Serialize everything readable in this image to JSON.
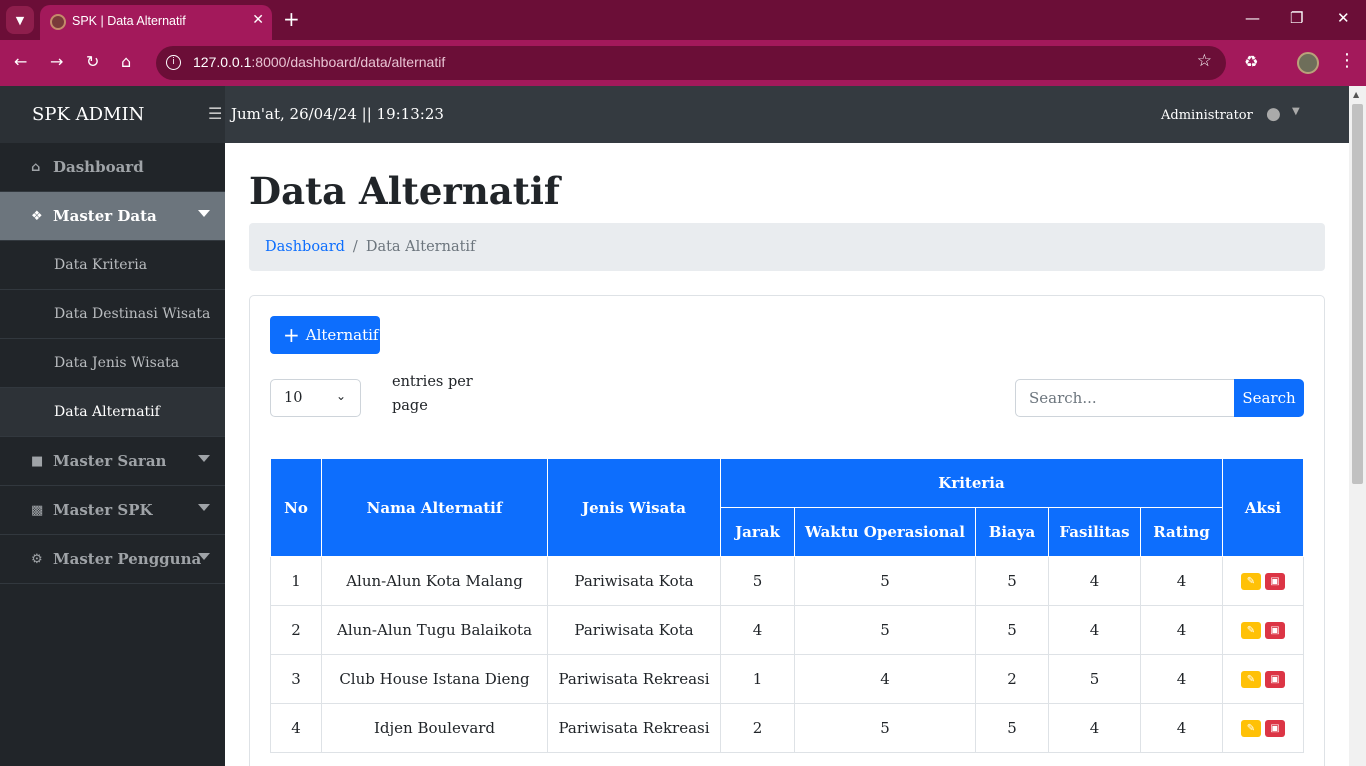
{
  "browser": {
    "tab_title": "SPK | Data Alternatif",
    "url_host": "127.0.0.1",
    "url_rest": ":8000/dashboard/data/alternatif"
  },
  "topbar": {
    "brand": "SPK ADMIN",
    "datetime": "Jum'at, 26/04/24 || 19:13:23",
    "user": "Administrator"
  },
  "sidebar": {
    "dashboard": "Dashboard",
    "master_data": "Master Data",
    "sub": [
      "Data Kriteria",
      "Data Destinasi Wisata",
      "Data Jenis Wisata",
      "Data Alternatif"
    ],
    "master_saran": "Master Saran",
    "master_spk": "Master SPK",
    "master_pengguna": "Master Pengguna"
  },
  "page": {
    "title": "Data Alternatif",
    "breadcrumb_link": "Dashboard",
    "breadcrumb_sep": "/",
    "breadcrumb_current": "Data Alternatif",
    "add_button": "Alternatif",
    "per_page": "10",
    "entries_label": "entries per page",
    "search_placeholder": "Search...",
    "search_button": "Search"
  },
  "table": {
    "headers": {
      "no": "No",
      "nama": "Nama Alternatif",
      "jenis": "Jenis Wisata",
      "kriteria": "Kriteria",
      "jarak": "Jarak",
      "waktu": "Waktu Operasional",
      "biaya": "Biaya",
      "fasilitas": "Fasilitas",
      "rating": "Rating",
      "aksi": "Aksi"
    },
    "rows": [
      {
        "no": "1",
        "nama": "Alun-Alun Kota Malang",
        "jenis": "Pariwisata Kota",
        "jarak": "5",
        "waktu": "5",
        "biaya": "5",
        "fasilitas": "4",
        "rating": "4"
      },
      {
        "no": "2",
        "nama": "Alun-Alun Tugu Balaikota",
        "jenis": "Pariwisata Kota",
        "jarak": "4",
        "waktu": "5",
        "biaya": "5",
        "fasilitas": "4",
        "rating": "4"
      },
      {
        "no": "3",
        "nama": "Club House Istana Dieng",
        "jenis": "Pariwisata Rekreasi",
        "jarak": "1",
        "waktu": "4",
        "biaya": "2",
        "fasilitas": "5",
        "rating": "4"
      },
      {
        "no": "4",
        "nama": "Idjen Boulevard",
        "jenis": "Pariwisata Rekreasi",
        "jarak": "2",
        "waktu": "5",
        "biaya": "5",
        "fasilitas": "4",
        "rating": "4"
      }
    ]
  },
  "colors": {
    "browser_frame": "#a3195b",
    "primary": "#0d6efd",
    "sidebar_bg": "#212529",
    "edit": "#ffc107",
    "delete": "#dc3545"
  }
}
